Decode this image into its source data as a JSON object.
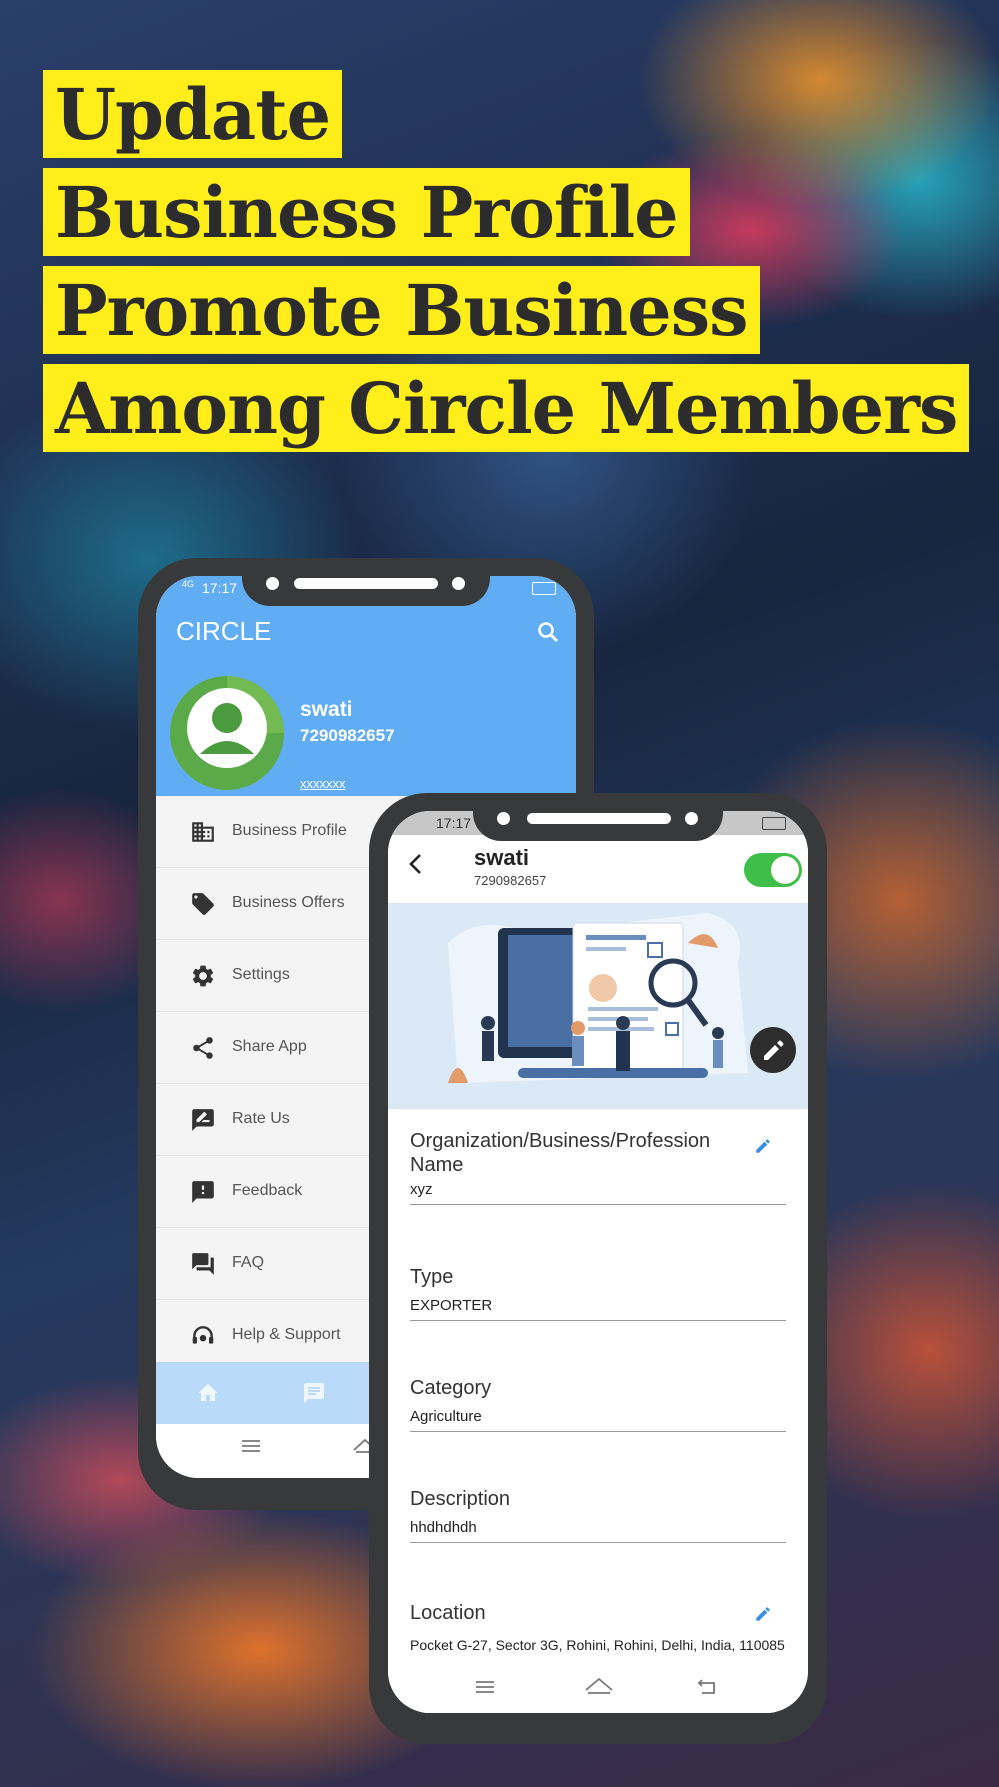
{
  "headline": [
    "Update",
    "Business Profile",
    "Promote Business",
    "Among Circle Members"
  ],
  "phone1": {
    "status_time": "17:17",
    "network": "4G",
    "app_title": "CIRCLE",
    "user": {
      "name": "swati",
      "phone": "7290982657",
      "address": "xxxxxxx"
    },
    "menu": [
      {
        "label": "Business Profile",
        "icon": "business-icon"
      },
      {
        "label": "Business Offers",
        "icon": "tag-icon"
      },
      {
        "label": "Settings",
        "icon": "gear-icon"
      },
      {
        "label": "Share App",
        "icon": "share-icon"
      },
      {
        "label": "Rate Us",
        "icon": "rate-icon"
      },
      {
        "label": "Feedback",
        "icon": "feedback-icon"
      },
      {
        "label": "FAQ",
        "icon": "faq-icon"
      },
      {
        "label": "Help & Support",
        "icon": "support-icon"
      }
    ]
  },
  "phone2": {
    "status_time": "17:17",
    "name": "swati",
    "phone": "7290982657",
    "active": true,
    "fields": [
      {
        "label": "Organization/Business/Profession Name",
        "value": "xyz",
        "editable": true
      },
      {
        "label": "Type",
        "value": "EXPORTER",
        "editable": false
      },
      {
        "label": "Category",
        "value": "Agriculture",
        "editable": false
      },
      {
        "label": "Description",
        "value": "hhdhdhdh",
        "editable": false
      },
      {
        "label": "Location",
        "value": "Pocket G-27, Sector 3G, Rohini, Rohini, Delhi, India, 110085",
        "editable": true
      }
    ]
  },
  "colors": {
    "highlight": "#ffee1a",
    "appbar": "#61adf3",
    "toggle": "#3fbf4a"
  }
}
